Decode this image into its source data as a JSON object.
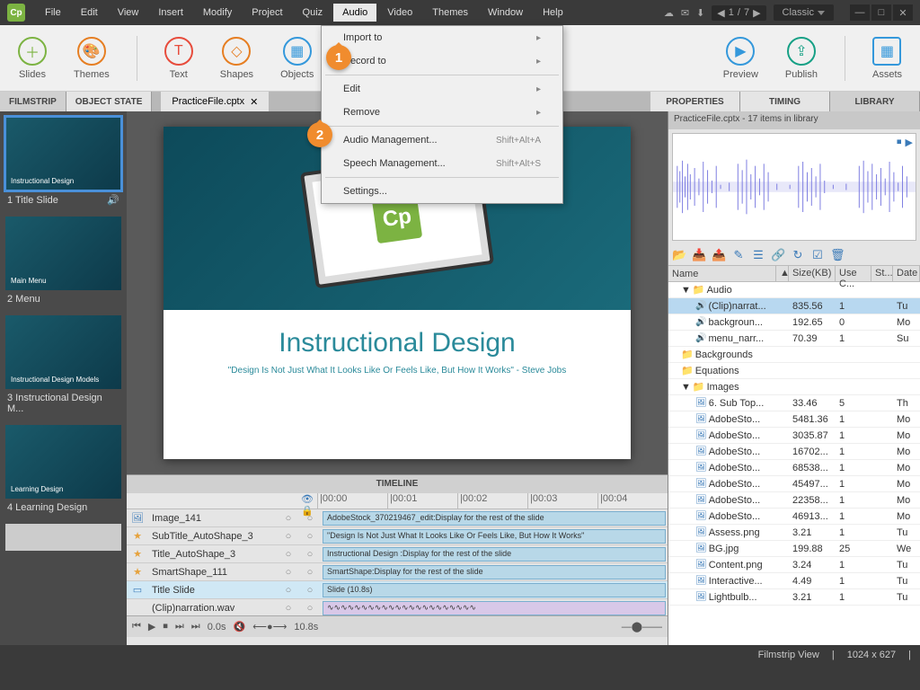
{
  "menubar": {
    "items": [
      "File",
      "Edit",
      "View",
      "Insert",
      "Modify",
      "Project",
      "Quiz",
      "Audio",
      "Video",
      "Themes",
      "Window",
      "Help"
    ],
    "activeIndex": 7,
    "page_current": "1",
    "page_total": "7",
    "workspace": "Classic"
  },
  "ribbon": {
    "buttons": [
      "Slides",
      "Themes",
      "Text",
      "Shapes",
      "Objects",
      "",
      "Preview",
      "Publish",
      "Assets"
    ]
  },
  "leftTabs": [
    "FILMSTRIP",
    "OBJECT STATE"
  ],
  "docTab": "PracticeFile.cptx",
  "rightTabs": [
    "PROPERTIES",
    "TIMING",
    "LIBRARY"
  ],
  "filmstrip": [
    {
      "label": "1 Title Slide",
      "hasAudio": true,
      "title": "Instructional Design"
    },
    {
      "label": "2 Menu",
      "title": "Main Menu"
    },
    {
      "label": "3 Instructional Design M...",
      "title": "Instructional Design Models"
    },
    {
      "label": "4 Learning Design",
      "title": "Learning Design"
    }
  ],
  "slide": {
    "title": "Instructional Design",
    "subtitle": "\"Design Is Not Just What It Looks Like Or Feels Like, But How It Works\" - Steve Jobs"
  },
  "timeline": {
    "header": "TIMELINE",
    "ticks": [
      "|00:00",
      "|00:01",
      "|00:02",
      "|00:03",
      "|00:04"
    ],
    "rows": [
      {
        "icon": "🖼",
        "name": "Image_141",
        "clip": "AdobeStock_370219467_edit:Display for the rest of the slide"
      },
      {
        "icon": "★",
        "name": "SubTitle_AutoShape_3",
        "clip": "\"Design Is Not Just What It Looks Like Or Feels Like, But How It Works\""
      },
      {
        "icon": "★",
        "name": "Title_AutoShape_3",
        "clip": "Instructional Design :Display for the rest of the slide"
      },
      {
        "icon": "★",
        "name": "SmartShape_111",
        "clip": "SmartShape:Display for the rest of the slide"
      },
      {
        "icon": "▭",
        "name": "Title Slide",
        "clip": "Slide (10.8s)"
      },
      {
        "icon": "",
        "name": "(Clip)narration.wav",
        "clip": ""
      }
    ],
    "controls": {
      "time": "0.0s",
      "end": "10.8s"
    }
  },
  "library": {
    "header": "PracticeFile.cptx - 17 items in library",
    "columns": [
      "Name",
      "Size(KB)",
      "Use C...",
      "St...",
      "Date"
    ],
    "rows": [
      {
        "type": "folder",
        "name": "Audio",
        "indent": 1,
        "expand": "▼"
      },
      {
        "type": "audio",
        "name": "(Clip)narrat...",
        "size": "835.56",
        "use": "1",
        "date": "Tu",
        "indent": 2,
        "selected": true
      },
      {
        "type": "audio",
        "name": "backgroun...",
        "size": "192.65",
        "use": "0",
        "date": "Mo",
        "indent": 2
      },
      {
        "type": "audio",
        "name": "menu_narr...",
        "size": "70.39",
        "use": "1",
        "date": "Su",
        "indent": 2
      },
      {
        "type": "folder",
        "name": "Backgrounds",
        "indent": 1
      },
      {
        "type": "folder",
        "name": "Equations",
        "indent": 1
      },
      {
        "type": "folder",
        "name": "Images",
        "indent": 1,
        "expand": "▼"
      },
      {
        "type": "image",
        "name": "6. Sub Top...",
        "size": "33.46",
        "use": "5",
        "date": "Th",
        "indent": 2
      },
      {
        "type": "image",
        "name": "AdobeSto...",
        "size": "5481.36",
        "use": "1",
        "date": "Mo",
        "indent": 2
      },
      {
        "type": "image",
        "name": "AdobeSto...",
        "size": "3035.87",
        "use": "1",
        "date": "Mo",
        "indent": 2
      },
      {
        "type": "image",
        "name": "AdobeSto...",
        "size": "16702...",
        "use": "1",
        "date": "Mo",
        "indent": 2
      },
      {
        "type": "image",
        "name": "AdobeSto...",
        "size": "68538...",
        "use": "1",
        "date": "Mo",
        "indent": 2
      },
      {
        "type": "image",
        "name": "AdobeSto...",
        "size": "45497...",
        "use": "1",
        "date": "Mo",
        "indent": 2
      },
      {
        "type": "image",
        "name": "AdobeSto...",
        "size": "22358...",
        "use": "1",
        "date": "Mo",
        "indent": 2
      },
      {
        "type": "image",
        "name": "AdobeSto...",
        "size": "46913...",
        "use": "1",
        "date": "Mo",
        "indent": 2
      },
      {
        "type": "image",
        "name": "Assess.png",
        "size": "3.21",
        "use": "1",
        "date": "Tu",
        "indent": 2
      },
      {
        "type": "image",
        "name": "BG.jpg",
        "size": "199.88",
        "use": "25",
        "date": "We",
        "indent": 2
      },
      {
        "type": "image",
        "name": "Content.png",
        "size": "3.24",
        "use": "1",
        "date": "Tu",
        "indent": 2
      },
      {
        "type": "image",
        "name": "Interactive...",
        "size": "4.49",
        "use": "1",
        "date": "Tu",
        "indent": 2
      },
      {
        "type": "image",
        "name": "Lightbulb...",
        "size": "3.21",
        "use": "1",
        "date": "Tu",
        "indent": 2
      }
    ]
  },
  "statusbar": {
    "view": "Filmstrip View",
    "dims": "1024 x 627"
  },
  "audioMenu": [
    {
      "label": "Import to",
      "sub": "▸"
    },
    {
      "label": "Record to",
      "sub": "▸"
    },
    {
      "sep": true
    },
    {
      "label": "Edit",
      "sub": "▸"
    },
    {
      "label": "Remove",
      "sub": "▸"
    },
    {
      "sep": true
    },
    {
      "label": "Audio Management...",
      "shortcut": "Shift+Alt+A"
    },
    {
      "label": "Speech Management...",
      "shortcut": "Shift+Alt+S"
    },
    {
      "sep": true
    },
    {
      "label": "Settings..."
    }
  ],
  "callouts": {
    "c1": "1",
    "c2": "2"
  }
}
